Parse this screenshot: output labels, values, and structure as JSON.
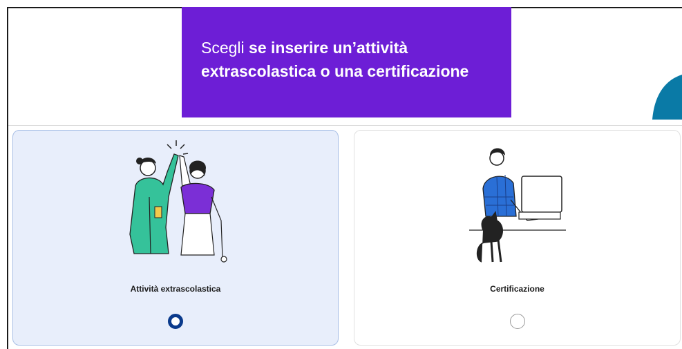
{
  "banner": {
    "line1_light": "Scegli",
    "line1_bold": " se inserire un’attività",
    "line2_bold": "extrascolastica o una certificazione",
    "color": "#6d1ed6"
  },
  "options": [
    {
      "label": "Attività extrascolastica",
      "selected": true,
      "illustration": "high-five-illustration"
    },
    {
      "label": "Certificazione",
      "selected": false,
      "illustration": "man-computer-cat-illustration"
    }
  ],
  "colors": {
    "selected_card_bg": "#e8eefb",
    "radio_selected": "#0a3a8c",
    "accent_teal": "#0a7aa6",
    "illustration_green": "#35c29a",
    "illustration_purple": "#7b2fd6",
    "illustration_blue": "#2a6fd6"
  }
}
